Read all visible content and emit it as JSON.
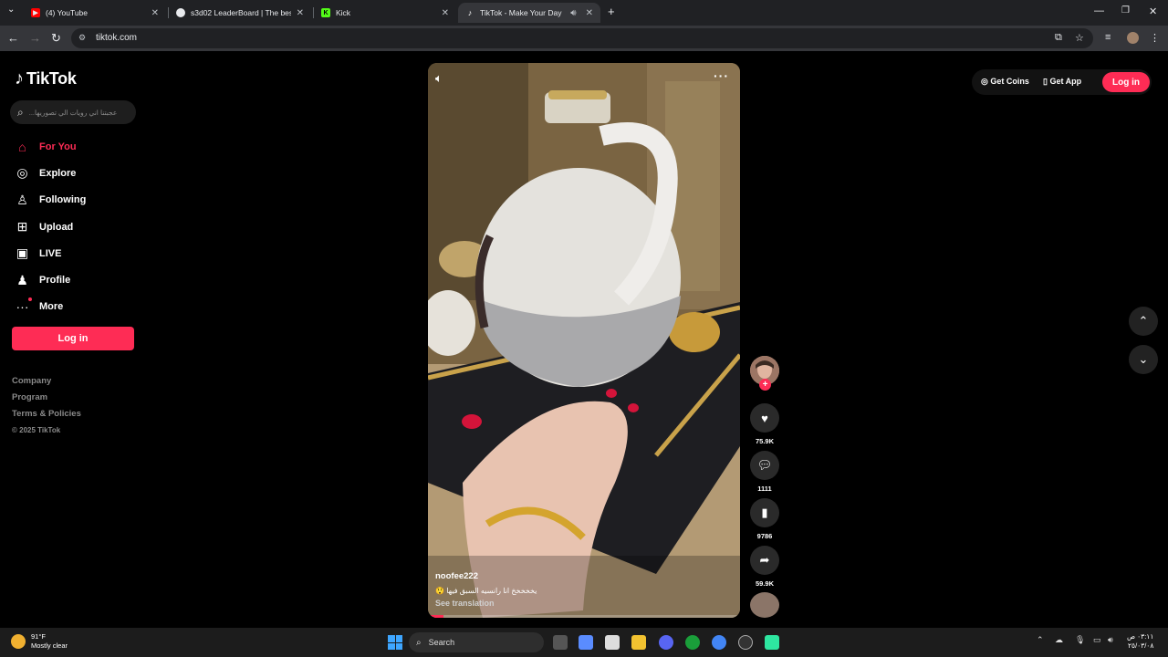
{
  "browser": {
    "tabs": [
      {
        "title": "(4) YouTube",
        "icon": "youtube-icon",
        "color": "#ff0000"
      },
      {
        "title": "s3d02 LeaderBoard | The best C",
        "icon": "site-icon",
        "color": "#e8eaed"
      },
      {
        "title": "Kick",
        "icon": "kick-icon",
        "color": "#53fc18"
      },
      {
        "title": "TikTok - Make Your Day",
        "icon": "tiktok-icon",
        "color": "#ffffff"
      }
    ],
    "url": "tiktok.com"
  },
  "sidebar": {
    "brand": "TikTok",
    "search_placeholder": "...عجبتنا اني رويات الي تصوريها",
    "nav": [
      {
        "label": "For You",
        "icon": "home-icon"
      },
      {
        "label": "Explore",
        "icon": "compass-icon"
      },
      {
        "label": "Following",
        "icon": "following-icon"
      },
      {
        "label": "Upload",
        "icon": "upload-icon"
      },
      {
        "label": "LIVE",
        "icon": "live-icon"
      },
      {
        "label": "Profile",
        "icon": "profile-icon"
      },
      {
        "label": "More",
        "icon": "more-icon"
      }
    ],
    "login": "Log in",
    "footer_links": [
      "Company",
      "Program",
      "Terms & Policies"
    ],
    "copyright": "© 2025 TikTok"
  },
  "video": {
    "username": "noofee222",
    "description": "😲 يخخخخخ انا رانسيه السبق فيها",
    "see_translation": "See translation",
    "progress": 0.05
  },
  "actions": {
    "likes": "75.9K",
    "comments": "1111",
    "saves": "9786",
    "shares": "59.9K"
  },
  "topbar": {
    "get_coins": "Get Coins",
    "get_app": "Get App",
    "login": "Log in"
  },
  "taskbar": {
    "temperature": "91°F",
    "weather": "Mostly clear",
    "search": "Search",
    "time": "٠٣:١١ ص",
    "date": "٢٥/٠٣/٠٨"
  },
  "colors": {
    "accent": "#fe2c55"
  }
}
